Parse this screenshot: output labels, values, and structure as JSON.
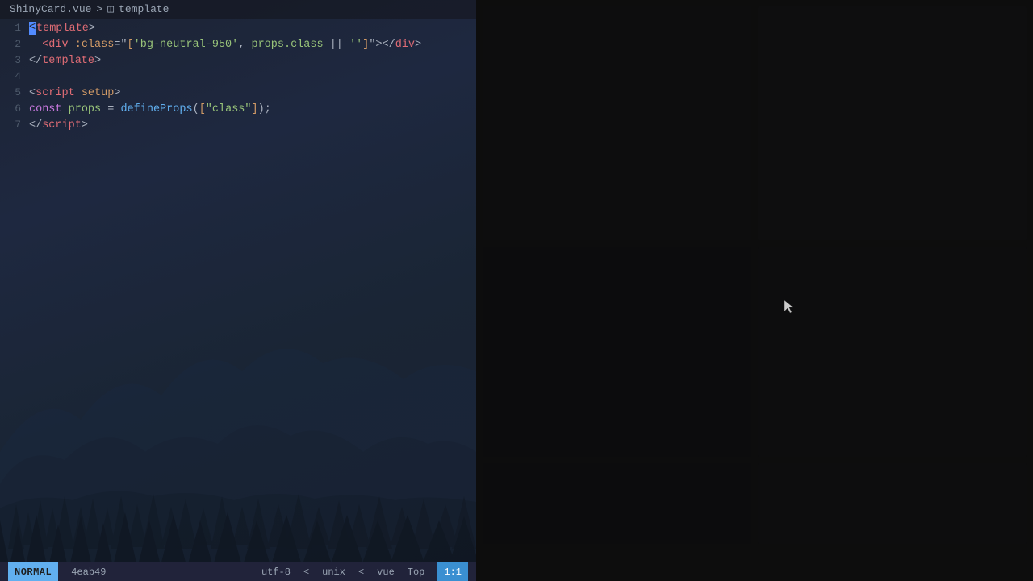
{
  "breadcrumb": {
    "filename": "ShinyCard.vue",
    "separator": ">",
    "icon": "◫",
    "section": "template"
  },
  "editor": {
    "lines": [
      {
        "num": 1,
        "hasCursor": true,
        "parts": [
          {
            "type": "tag",
            "text": "<template"
          },
          {
            "type": "punct",
            "text": ">"
          }
        ]
      },
      {
        "num": 2,
        "hasCursor": false,
        "parts": [
          {
            "type": "punct",
            "text": "  "
          },
          {
            "type": "tag",
            "text": "<div"
          },
          {
            "type": "punct",
            "text": " "
          },
          {
            "type": "attr-name",
            "text": ":class"
          },
          {
            "type": "punct",
            "text": "=\""
          },
          {
            "type": "bracket",
            "text": "["
          },
          {
            "type": "string",
            "text": "'bg-neutral-950'"
          },
          {
            "type": "punct",
            "text": ", "
          },
          {
            "type": "attr-value",
            "text": "props.class"
          },
          {
            "type": "punct",
            "text": " || "
          },
          {
            "type": "string",
            "text": "''"
          },
          {
            "type": "bracket",
            "text": "]"
          },
          {
            "type": "punct",
            "text": "\">"
          },
          {
            "type": "tag",
            "text": "</div"
          },
          {
            "type": "punct",
            "text": ">"
          }
        ]
      },
      {
        "num": 3,
        "hasCursor": false,
        "parts": [
          {
            "type": "tag",
            "text": "</template"
          },
          {
            "type": "punct",
            "text": ">"
          }
        ]
      },
      {
        "num": 4,
        "hasCursor": false,
        "parts": []
      },
      {
        "num": 5,
        "hasCursor": false,
        "parts": [
          {
            "type": "tag",
            "text": "<script"
          },
          {
            "type": "punct",
            "text": " "
          },
          {
            "type": "attr-name",
            "text": "setup"
          },
          {
            "type": "punct",
            "text": ">"
          }
        ]
      },
      {
        "num": 6,
        "hasCursor": false,
        "parts": [
          {
            "type": "keyword",
            "text": "const"
          },
          {
            "type": "punct",
            "text": " "
          },
          {
            "type": "attr-value",
            "text": "props"
          },
          {
            "type": "punct",
            "text": " = "
          },
          {
            "type": "fn-name",
            "text": "defineProps"
          },
          {
            "type": "punct",
            "text": "("
          },
          {
            "type": "bracket",
            "text": "["
          },
          {
            "type": "string",
            "text": "\"class\""
          },
          {
            "type": "bracket",
            "text": "]"
          },
          {
            "type": "punct",
            "text": ");"
          }
        ]
      },
      {
        "num": 7,
        "hasCursor": false,
        "parts": [
          {
            "type": "tag",
            "text": "</script"
          },
          {
            "type": "punct",
            "text": ">"
          }
        ]
      }
    ]
  },
  "status_bar": {
    "mode": "NORMAL",
    "git_branch": "4eab49",
    "encoding": "utf-8",
    "eol": "unix",
    "filetype": "vue",
    "scroll": "Top",
    "position": "1:1"
  },
  "colors": {
    "mode_bg": "#61afef",
    "pos_bg": "#3a8fd1"
  }
}
